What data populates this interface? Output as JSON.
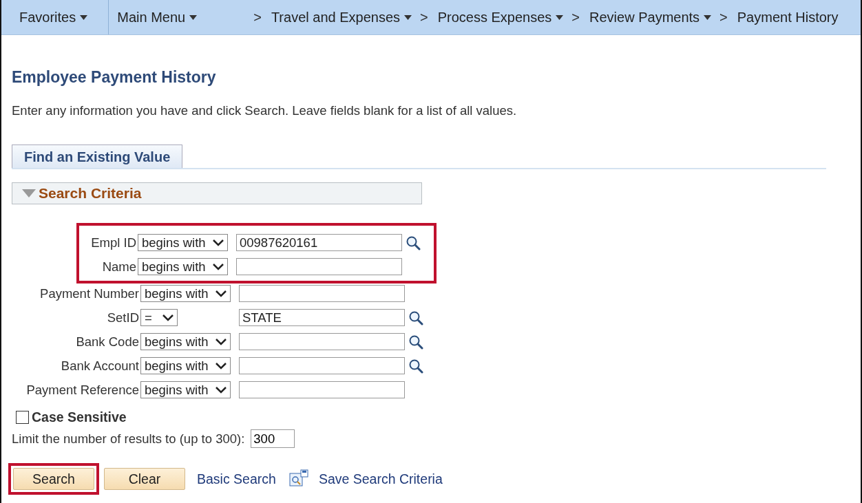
{
  "nav": [
    {
      "label": "Favorites",
      "menu": true
    },
    {
      "label": "Main Menu",
      "menu": true
    },
    {
      "label": "Travel and Expenses",
      "separator": ">",
      "menu": true
    },
    {
      "label": "Process Expenses",
      "separator": ">",
      "menu": true
    },
    {
      "label": "Review Payments",
      "separator": ">",
      "menu": true
    },
    {
      "label": "Payment History",
      "separator": ">",
      "menu": false
    }
  ],
  "title": "Employee Payment History",
  "instructions": "Enter any information you have and click Search. Leave fields blank for a list of all values.",
  "tabs": [
    {
      "label": "Find an Existing Value",
      "selected": true
    }
  ],
  "section": {
    "title": "Search Criteria",
    "expanded": true
  },
  "criteria": [
    {
      "label": "Empl ID",
      "operator": "begins with",
      "value": "00987620161",
      "lookup": true,
      "highlighted": true
    },
    {
      "label": "Name",
      "operator": "begins with",
      "lookup": false,
      "highlighted": true
    },
    {
      "label": "Payment Number",
      "operator": "begins with",
      "lookup": false,
      "highlighted": false
    },
    {
      "label": "SetID",
      "operator": "=",
      "value": "STATE",
      "lookup": true,
      "highlighted": false
    },
    {
      "label": "Bank Code",
      "operator": "begins with",
      "lookup": true,
      "highlighted": false
    },
    {
      "label": "Bank Account",
      "operator": "begins with",
      "lookup": true,
      "highlighted": false
    },
    {
      "label": "Payment Reference",
      "operator": "begins with",
      "lookup": false,
      "highlighted": false
    }
  ],
  "case_sensitive": {
    "label": "Case Sensitive",
    "checked": false
  },
  "limit": {
    "label": "Limit the number of results to (up to 300):",
    "value": "300"
  },
  "actions": [
    {
      "kind": "button",
      "label": "Search",
      "highlighted": true
    },
    {
      "kind": "button",
      "label": "Clear",
      "highlighted": false
    },
    {
      "kind": "link",
      "label": "Basic Search",
      "icon": false
    },
    {
      "kind": "link",
      "label": "Save Search Criteria",
      "icon": true
    }
  ]
}
